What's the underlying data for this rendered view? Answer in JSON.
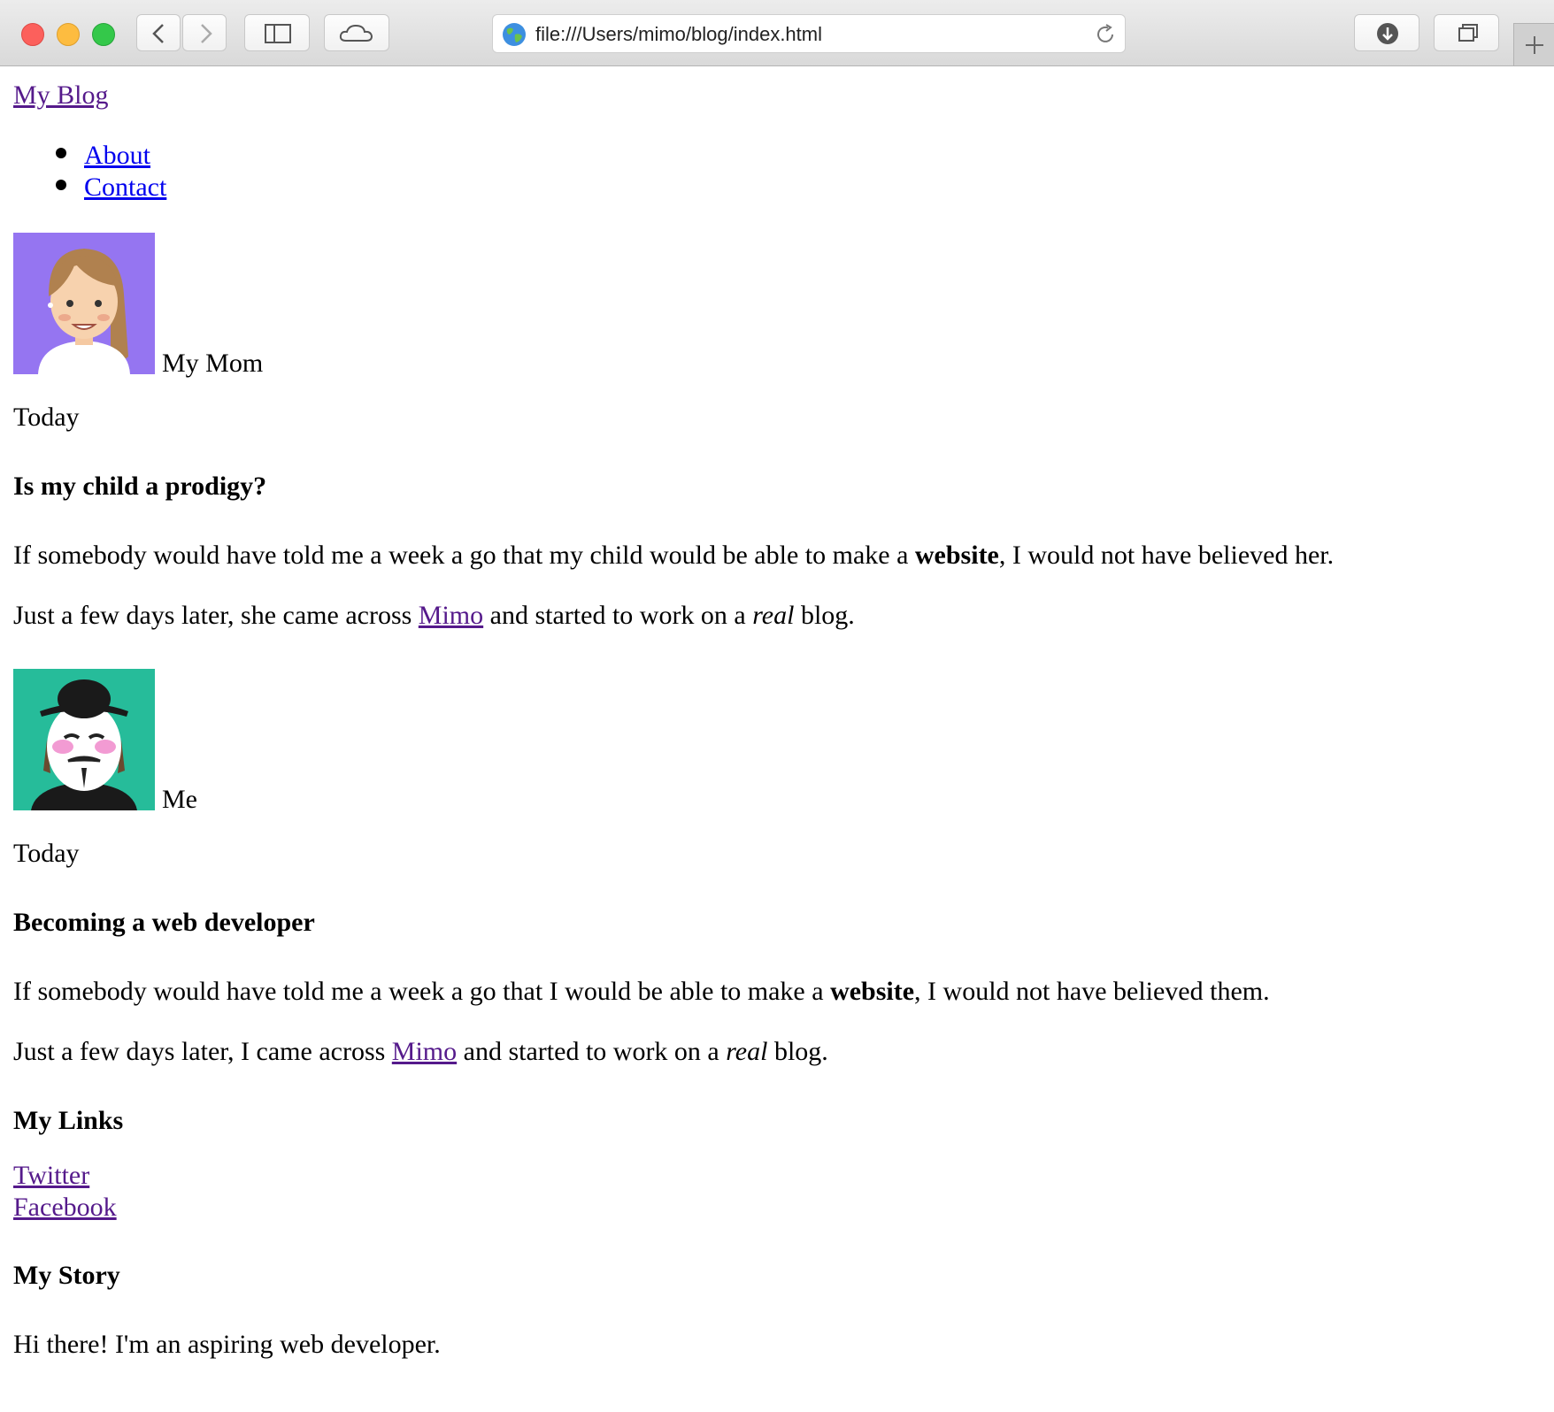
{
  "browser": {
    "url": "file:///Users/mimo/blog/index.html"
  },
  "header": {
    "blog_title": "My Blog",
    "nav": [
      "About",
      "Contact"
    ]
  },
  "posts": [
    {
      "author": "My Mom",
      "date": "Today",
      "title": "Is my child a prodigy?",
      "p1_before": "If somebody would have told me a week a go that my child would be able to make a ",
      "p1_bold": "website",
      "p1_after": ", I would not have believed her.",
      "p2_before": "Just a few days later, she came across ",
      "p2_link": "Mimo",
      "p2_middle": " and started to work on a ",
      "p2_italic": "real",
      "p2_after": " blog."
    },
    {
      "author": "Me",
      "date": "Today",
      "title": "Becoming a web developer",
      "p1_before": "If somebody would have told me a week a go that I would be able to make a ",
      "p1_bold": "website",
      "p1_after": ", I would not have believed them.",
      "p2_before": "Just a few days later, I came across ",
      "p2_link": "Mimo",
      "p2_middle": " and started to work on a ",
      "p2_italic": "real",
      "p2_after": " blog."
    }
  ],
  "links": {
    "heading": "My Links",
    "items": [
      "Twitter",
      "Facebook"
    ]
  },
  "story": {
    "heading": "My Story",
    "text": "Hi there! I'm an aspiring web developer."
  }
}
